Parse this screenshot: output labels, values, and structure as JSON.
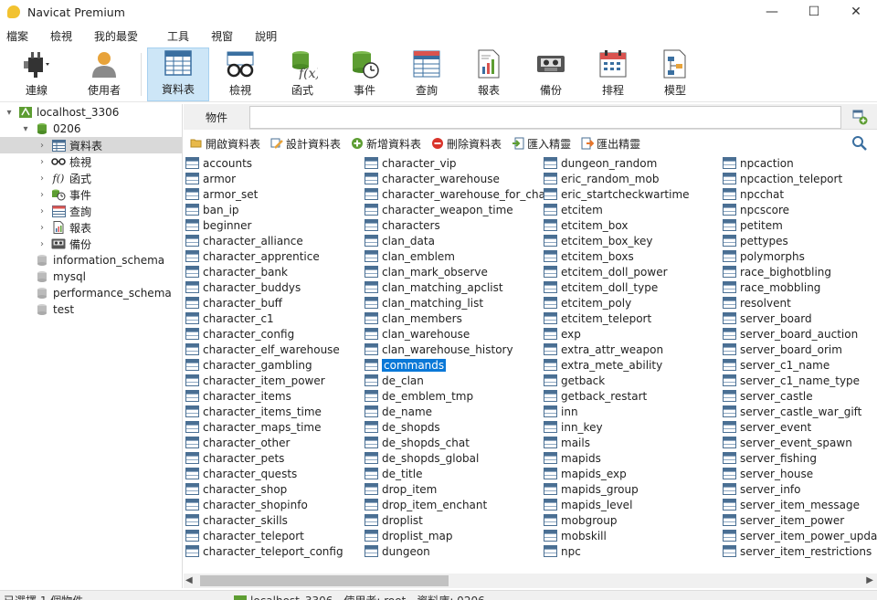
{
  "window": {
    "title": "Navicat Premium",
    "min": "—",
    "max": "☐",
    "close": "✕"
  },
  "menu": [
    "檔案",
    "檢視",
    "我的最愛",
    "工具",
    "視窗",
    "說明"
  ],
  "toolbar": [
    {
      "label": "連線",
      "icon": "plug-icon"
    },
    {
      "label": "使用者",
      "icon": "user-icon"
    },
    {
      "label": "資料表",
      "icon": "table-icon",
      "active": true
    },
    {
      "label": "檢視",
      "icon": "glasses-icon"
    },
    {
      "label": "函式",
      "icon": "function-icon"
    },
    {
      "label": "事件",
      "icon": "event-icon"
    },
    {
      "label": "查詢",
      "icon": "query-icon"
    },
    {
      "label": "報表",
      "icon": "report-icon"
    },
    {
      "label": "備份",
      "icon": "backup-icon"
    },
    {
      "label": "排程",
      "icon": "schedule-icon"
    },
    {
      "label": "模型",
      "icon": "model-icon"
    }
  ],
  "tree": {
    "connection": "localhost_3306",
    "database": "0206",
    "children": [
      "資料表",
      "檢視",
      "函式",
      "事件",
      "查詢",
      "報表",
      "備份"
    ],
    "other_dbs": [
      "information_schema",
      "mysql",
      "performance_schema",
      "test"
    ]
  },
  "object_tab": "物件",
  "actions": [
    "開啟資料表",
    "設計資料表",
    "新增資料表",
    "刪除資料表",
    "匯入精靈",
    "匯出精靈"
  ],
  "tables": {
    "col1": [
      "accounts",
      "armor",
      "armor_set",
      "ban_ip",
      "beginner",
      "character_alliance",
      "character_apprentice",
      "character_bank",
      "character_buddys",
      "character_buff",
      "character_c1",
      "character_config",
      "character_elf_warehouse",
      "character_gambling",
      "character_item_power",
      "character_items",
      "character_items_time",
      "character_maps_time",
      "character_other",
      "character_pets",
      "character_quests",
      "character_shop",
      "character_shopinfo",
      "character_skills",
      "character_teleport",
      "character_teleport_config"
    ],
    "col2": [
      "character_vip",
      "character_warehouse",
      "character_warehouse_for_cha",
      "character_weapon_time",
      "characters",
      "clan_data",
      "clan_emblem",
      "clan_mark_observe",
      "clan_matching_apclist",
      "clan_matching_list",
      "clan_members",
      "clan_warehouse",
      "clan_warehouse_history",
      "commands",
      "de_clan",
      "de_emblem_tmp",
      "de_name",
      "de_shopds",
      "de_shopds_chat",
      "de_shopds_global",
      "de_title",
      "drop_item",
      "drop_item_enchant",
      "droplist",
      "droplist_map",
      "dungeon"
    ],
    "col3": [
      "dungeon_random",
      "eric_random_mob",
      "eric_startcheckwartime",
      "etcitem",
      "etcitem_box",
      "etcitem_box_key",
      "etcitem_boxs",
      "etcitem_doll_power",
      "etcitem_doll_type",
      "etcitem_poly",
      "etcitem_teleport",
      "exp",
      "extra_attr_weapon",
      "extra_mete_ability",
      "getback",
      "getback_restart",
      "inn",
      "inn_key",
      "mails",
      "mapids",
      "mapids_exp",
      "mapids_group",
      "mapids_level",
      "mobgroup",
      "mobskill",
      "npc"
    ],
    "col4": [
      "npcaction",
      "npcaction_teleport",
      "npcchat",
      "npcscore",
      "petitem",
      "pettypes",
      "polymorphs",
      "race_bighotbling",
      "race_mobbling",
      "resolvent",
      "server_board",
      "server_board_auction",
      "server_board_orim",
      "server_c1_name",
      "server_c1_name_type",
      "server_castle",
      "server_castle_war_gift",
      "server_event",
      "server_event_spawn",
      "server_fishing",
      "server_house",
      "server_info",
      "server_item_message",
      "server_item_power",
      "server_item_power_update",
      "server_item_restrictions"
    ],
    "selected": "commands"
  },
  "status": {
    "selection": "已選擇 1 個物件",
    "connection": "localhost_3306",
    "user": "使用者: root",
    "database": "資料庫: 0206"
  }
}
